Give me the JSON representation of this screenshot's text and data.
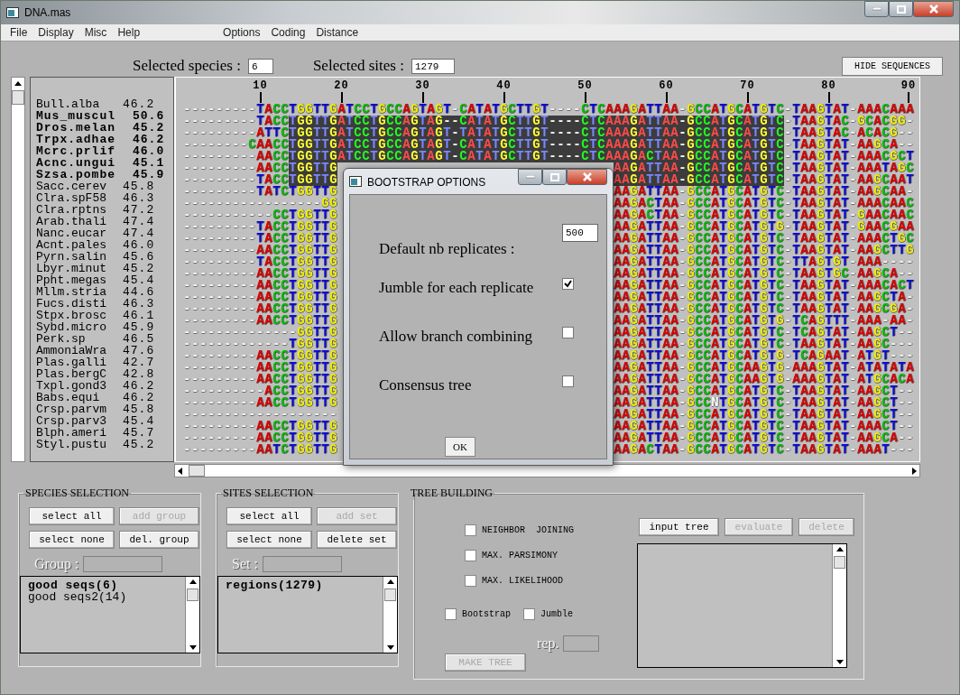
{
  "window": {
    "title": "DNA.mas"
  },
  "menu": {
    "main": [
      "File",
      "Display",
      "Misc",
      "Help"
    ],
    "extra": [
      "Options",
      "Coding",
      "Distance"
    ]
  },
  "header": {
    "species_label": "Selected species :",
    "species_value": "6",
    "sites_label": "Selected sites :",
    "sites_value": "1279",
    "hide_button": "HIDE SEQUENCES"
  },
  "ruler": [
    "10",
    "20",
    "30",
    "40",
    "50",
    "60",
    "70",
    "80",
    "90"
  ],
  "species": [
    {
      "name": "Bull.alba",
      "score": "46.2",
      "selected": false,
      "sequence": "---------TACCTGGTTGATCCTGCCAGTAGT-CATATGCTTGT----CTCAAAGATTAA-GCCATGCATGTC-TAAGTAT-AAACAAA"
    },
    {
      "name": "Mus_muscul",
      "score": "50.6",
      "selected": true,
      "sequence": "---------TACCTGGTTGATCCTGCCAGTAG--CATATGCTTGT----CTCAAAGATTAA-GCCATGCATGTC-TAAGTAC-GCACGG-"
    },
    {
      "name": "Dros.melan",
      "score": "45.2",
      "selected": true,
      "sequence": "---------ATTCTGGTTGATCCTGCCAGTAGT-TATATGCTTGT----CTCAAAGATTAA-GCCATGCATGTC-TAAGTAC-ACACG--"
    },
    {
      "name": "Trpx.adhae",
      "score": "46.2",
      "selected": true,
      "sequence": "--------CAACCTGGTTGATCCTGCCAGTAGT-CATATGCTTGT----CTCAAAGATTAA-GCCATGCATGTC-TAAGTAT-AAGCA--"
    },
    {
      "name": "Mcrc.prlif",
      "score": "46.0",
      "selected": true,
      "sequence": "---------AACCTGGTTGATCCTGCCAGTAGT-CATATGCTTGT----CTCAAAGACTAA-GCCATGCATGTC-TAAGTAT-AAACGCT"
    },
    {
      "name": "Acnc.ungui",
      "score": "45.1",
      "selected": true,
      "left": "---------AACCTGGTTG",
      "right": "AAGATTAA-GCCATGCATGTC-TAAGTAT-AAATAGC"
    },
    {
      "name": "Szsa.pombe",
      "score": "45.9",
      "selected": true,
      "left": "---------TACCTGGTTG",
      "right": "AAGATTAA-GCCATGCATGTC-TAAGTAT-AAGCAAT"
    },
    {
      "name": "Sacc.cerev",
      "score": "45.8",
      "selected": false,
      "left": "---------TATCTGGTTG",
      "right": "AAGATTAA-GCCATGCATGTC-TAAGTAT-AAGCAA-"
    },
    {
      "name": "Clra.spF58",
      "score": "46.3",
      "selected": false,
      "left": "-----------------GG",
      "right": "AAGACTAA-GCCATGCATGTC-TAAGTAT-AAACAAC"
    },
    {
      "name": "Clra.rptns",
      "score": "47.2",
      "selected": false,
      "left": "-----------CCTGGTTG",
      "right": "AAGACTAA-GCCATGCATGTC-TAAGTAT-GAACAAC"
    },
    {
      "name": "Arab.thali",
      "score": "47.4",
      "selected": false,
      "left": "---------TACCTGGTTG",
      "right": "AAGATTAA-GCCATGCATGTG-TAAGTAT-GAACGAA"
    },
    {
      "name": "Nanc.eucar",
      "score": "47.4",
      "selected": false,
      "left": "---------TACCTGGTTG",
      "right": "AAGATTAA-GCCATGCATGTC-TAAGTAT-AAACTGC"
    },
    {
      "name": "Acnt.pales",
      "score": "46.0",
      "selected": false,
      "left": "---------AACCTGGTTG",
      "right": "AAGATTAA-GCCATGCATGTC-TAAGTAT-AAGCTTG"
    },
    {
      "name": "Pyrn.salin",
      "score": "45.6",
      "selected": false,
      "left": "---------TACCTGGTTG",
      "right": "AAGATTAA-GCCATGCATGTC-TTAGTGT-AAA----"
    },
    {
      "name": "Lbyr.minut",
      "score": "45.2",
      "selected": false,
      "left": "---------AACCTGGTTG",
      "right": "AAGATTAA-GCCATGCATGTC-TAAGTGC-AAGCA--"
    },
    {
      "name": "Ppht.megas",
      "score": "45.4",
      "selected": false,
      "left": "---------AACCTGGTTG",
      "right": "AAGATTAA-GCCATGCATGTC-TAAGTAT-AAACACT"
    },
    {
      "name": "Mllm.stria",
      "score": "44.6",
      "selected": false,
      "left": "---------AACCTGGTTG",
      "right": "AAGATTAA-GCCATGCATGTC-TAAGTAT-AAGCTA-"
    },
    {
      "name": "Fucs.disti",
      "score": "46.3",
      "selected": false,
      "left": "---------AACCTGGTTG",
      "right": "AAGATTAA-GCCATGCATGTC-TAAGTAT-AAGCGA-"
    },
    {
      "name": "Stpx.brosc",
      "score": "46.1",
      "selected": false,
      "left": "---------AACCTGGTTG",
      "right": "AAGATTAA-GCCATGCATGTG-TCAGTTT-AAA-AA-"
    },
    {
      "name": "Sybd.micro",
      "score": "45.9",
      "selected": false,
      "left": "--------------GGTTG",
      "right": "AAGATTAA-GCCATGCATGTC-TCAGTAT-AAGCT--"
    },
    {
      "name": "Perk.sp",
      "score": "46.5",
      "selected": false,
      "left": "-------------TGGTTG",
      "right": "AAGATTAA-GCCATGCATGTC-TAAGTAT-AAGC---"
    },
    {
      "name": "AmmoniaWra",
      "score": "47.6",
      "selected": false,
      "left": "---------AACCTGGTTG",
      "right": "AAGATTAA-GCCATGCATGTG-TCAGAAT-ATGT---"
    },
    {
      "name": "Plas.galli",
      "score": "42.7",
      "selected": false,
      "left": "---------AACCTGGTTG",
      "right": "AAGATTAA-GCCATGCAAGTG-AAAGTAT-ATATATA"
    },
    {
      "name": "Plas.bergC",
      "score": "42.8",
      "selected": false,
      "left": "---------AACCTGGTTG",
      "right": "AAGATTAA-GCCATGCAAGTG-AAAGTAT-ATGCACA"
    },
    {
      "name": "Txpl.gond3",
      "score": "46.2",
      "selected": false,
      "left": "----------ACCTGGTTG",
      "right": "AAGATTAA-GCCATGCATGTC-TAAGTAT-AAGCT--"
    },
    {
      "name": "Babs.equi",
      "score": "46.2",
      "selected": false,
      "left": "---------AACCTGGTTG",
      "right": "AAGATTAA-GCCNTGCATGTC-TAAGTAT-AAGCT--"
    },
    {
      "name": "Crsp.parvm",
      "score": "45.8",
      "selected": false,
      "left": "-------------------",
      "right": "AAGATTAA-GCCATGCATGTC-TAAGTAT-AAGCT--"
    },
    {
      "name": "Crsp.parv3",
      "score": "45.4",
      "selected": false,
      "left": "---------AACCTGGTTG",
      "right": "AAGATTAA-GCCATGCATGTC-TAAGTAT-AAACT--"
    },
    {
      "name": "Blph.ameri",
      "score": "45.7",
      "selected": false,
      "left": "---------AACCTGGTTG",
      "right": "AAGATTAA-GCCATGCATGTC-TAAGTAT-AAGCA--"
    },
    {
      "name": "Styl.pustu",
      "score": "45.2",
      "selected": false,
      "left": "---------AATCTGGTTG",
      "right": "AAGACTAA-GCCATGCATGTC-TAAGTAT-AAAT---"
    }
  ],
  "species_selection": {
    "title": "SPECIES SELECTION",
    "buttons": [
      {
        "label": "select all",
        "disabled": false
      },
      {
        "label": "add group",
        "disabled": true
      },
      {
        "label": "select none",
        "disabled": false
      },
      {
        "label": "del. group",
        "disabled": false
      }
    ],
    "field_label": "Group :",
    "items": [
      {
        "label": "good seqs(6)",
        "selected": true
      },
      {
        "label": "good seqs2(14)",
        "selected": false
      }
    ]
  },
  "sites_selection": {
    "title": "SITES SELECTION",
    "buttons": [
      {
        "label": "select all",
        "disabled": false
      },
      {
        "label": "add set",
        "disabled": true
      },
      {
        "label": "select none",
        "disabled": false
      },
      {
        "label": "delete set",
        "disabled": false
      }
    ],
    "field_label": "Set :",
    "items": [
      {
        "label": "regions(1279)",
        "selected": true
      }
    ]
  },
  "tree_building": {
    "title": "TREE BUILDING",
    "methods": [
      {
        "label": "NEIGHBOR  JOINING",
        "checked": false
      },
      {
        "label": "MAX. PARSIMONY",
        "checked": false
      },
      {
        "label": "MAX. LIKELIHOOD",
        "checked": false
      }
    ],
    "options": [
      {
        "label": "Bootstrap",
        "checked": false
      },
      {
        "label": "Jumble",
        "checked": false
      }
    ],
    "rep_label": "rep.",
    "make_button": {
      "label": "MAKE  TREE",
      "disabled": true
    },
    "tree_buttons": [
      {
        "label": "input tree",
        "disabled": false
      },
      {
        "label": "evaluate",
        "disabled": true
      },
      {
        "label": "delete",
        "disabled": true
      }
    ]
  },
  "dialog": {
    "title": "BOOTSTRAP OPTIONS",
    "fields": [
      {
        "kind": "number",
        "label": "Default nb replicates :",
        "value": "500"
      },
      {
        "kind": "checkbox",
        "label": "Jumble for each replicate",
        "checked": true
      },
      {
        "kind": "checkbox",
        "label": "Allow branch combining",
        "checked": false
      },
      {
        "kind": "checkbox",
        "label": "Consensus tree",
        "checked": false
      }
    ],
    "ok": "OK"
  }
}
